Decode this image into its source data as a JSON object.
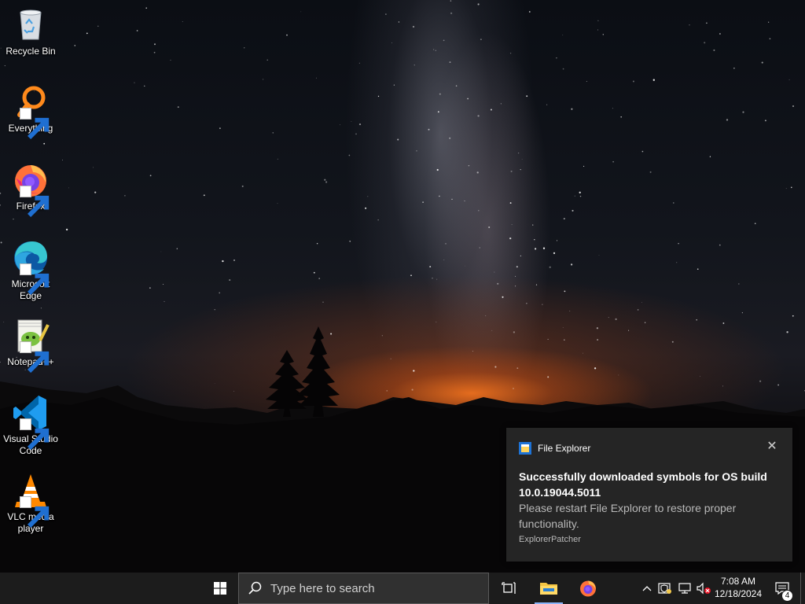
{
  "desktop": {
    "icons": [
      {
        "label": "Recycle Bin",
        "icon": "recycle-bin-icon",
        "shortcut": false
      },
      {
        "label": "Everything",
        "icon": "everything-search-icon",
        "shortcut": true
      },
      {
        "label": "Firefox",
        "icon": "firefox-icon",
        "shortcut": true
      },
      {
        "label": "Microsoft Edge",
        "icon": "edge-icon",
        "shortcut": true
      },
      {
        "label": "Notepad++",
        "icon": "notepad-plus-plus-icon",
        "shortcut": true
      },
      {
        "label": "Visual Studio Code",
        "icon": "vscode-icon",
        "shortcut": true
      },
      {
        "label": "VLC media player",
        "icon": "vlc-icon",
        "shortcut": true
      }
    ]
  },
  "toast": {
    "app_name": "File Explorer",
    "close_symbol": "✕",
    "title": "Successfully downloaded symbols for OS build 10.0.19044.5011",
    "body": "Please restart File Explorer to restore proper functionality.",
    "source": "ExplorerPatcher"
  },
  "taskbar": {
    "search_placeholder": "Type here to search",
    "pinned": [
      {
        "name": "task-view",
        "icon": "task-view-icon"
      },
      {
        "name": "file-explorer",
        "icon": "folder-icon",
        "running": true
      },
      {
        "name": "firefox",
        "icon": "firefox-icon",
        "running": false
      }
    ],
    "tray": {
      "chevron": "^",
      "time": "7:08 AM",
      "date": "12/18/2024",
      "notification_count": "4"
    }
  },
  "colors": {
    "taskbar": "#1c1c1c",
    "toast_bg": "#262626",
    "accent": "#8ab4f8"
  }
}
